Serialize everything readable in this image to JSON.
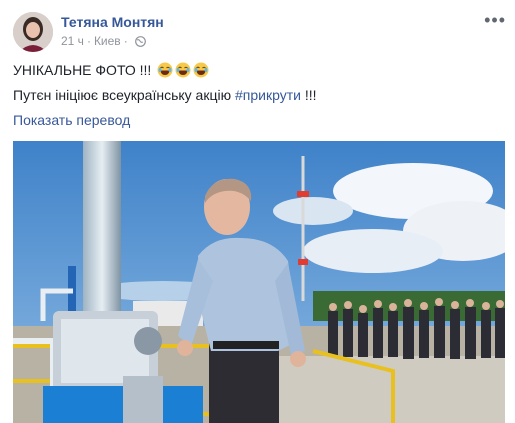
{
  "post": {
    "author": "Тетяна Монтян",
    "time": "21 ч",
    "separator": "·",
    "location": "Киев",
    "more_label": "•••",
    "text_line1": "УНІКАЛЬНЕ ФОТО !!!",
    "text_line2_prefix": "Путєн ініціює всеукраїнську акцію ",
    "hashtag": "#прикрути",
    "text_line2_suffix": " !!!",
    "translate_link": "Показать перевод",
    "emoji_icons": [
      "laughing-face-icon",
      "laughing-face-icon",
      "laughing-face-icon"
    ]
  },
  "colors": {
    "link": "#365899",
    "meta": "#90949c",
    "text": "#1d2129"
  }
}
